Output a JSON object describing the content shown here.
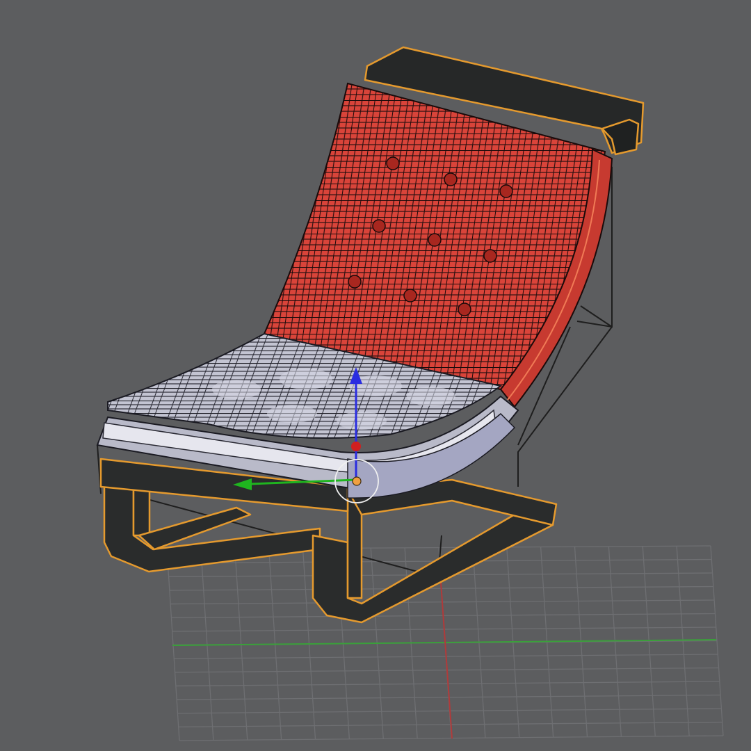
{
  "viewport": {
    "background": "#5c5d5f",
    "grid_color": "#6e6f72",
    "axis_x_color": "#b03a3a",
    "axis_y_color": "#3aa03a"
  },
  "model": {
    "frame_color": "#2a2c2c",
    "selection_outline_color": "#e59a2e",
    "backrest_color": "#d9443a",
    "seat_color": "#c9c9d6",
    "wire_color": "#1b1b1b"
  },
  "gizmo": {
    "z_axis_color": "#2a2de0",
    "y_axis_color": "#1fb51f",
    "origin_color": "#d02020",
    "pivot_color": "#f0a040"
  }
}
